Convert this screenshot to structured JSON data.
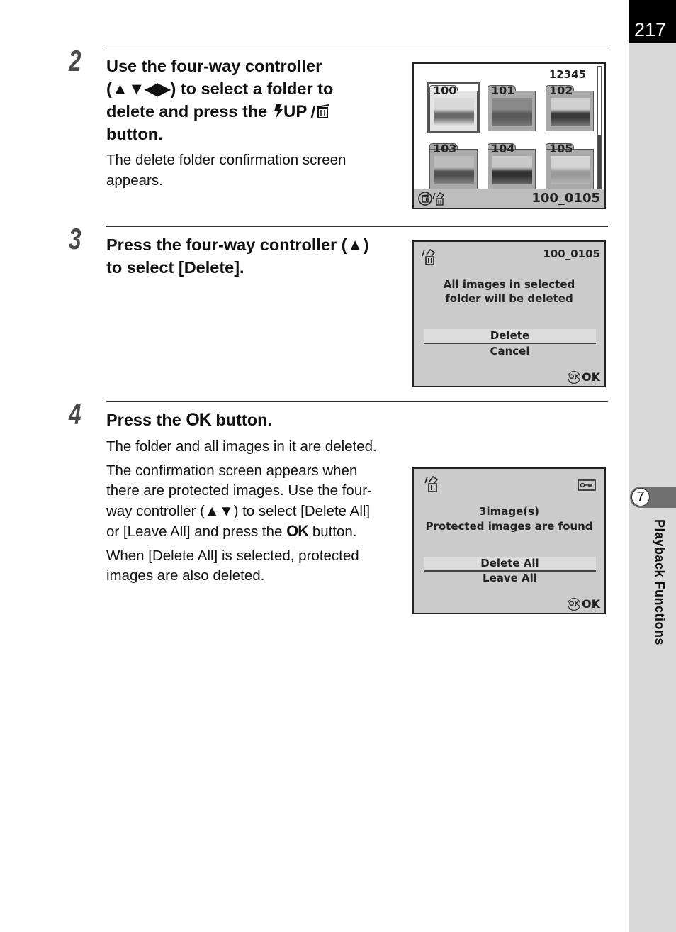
{
  "page": {
    "number": "217",
    "chapter_number": "7",
    "chapter_title": "Playback Functions"
  },
  "steps": [
    {
      "number": "2",
      "heading_lines": [
        "Use the four-way controller",
        "(▲▼◀▶) to select a folder to",
        "delete and press the ",
        "button."
      ],
      "heading_glyph": "⚡UP/🗑",
      "body": [
        "The delete folder confirmation screen",
        "appears."
      ]
    },
    {
      "number": "3",
      "heading_lines": [
        "Press the four-way controller (▲)",
        "to select [Delete]."
      ]
    },
    {
      "number": "4",
      "heading_pre": "Press the ",
      "heading_ok": "OK",
      "heading_post": " button.",
      "body": [
        "The folder and all images in it are deleted.",
        "The confirmation screen appears when",
        "there are protected images. Use the four-",
        "way controller (▲▼) to select [Delete All]",
        "or [Leave All] and press the ",
        " button.",
        "When [Delete All] is selected, protected",
        "images are also deleted."
      ],
      "body_ok": "OK"
    }
  ],
  "screens": {
    "folder_list": {
      "counter": "12345",
      "folders": [
        {
          "label": "100",
          "selected": true
        },
        {
          "label": "101",
          "selected": false
        },
        {
          "label": "102",
          "selected": false
        },
        {
          "label": "103",
          "selected": false
        },
        {
          "label": "104",
          "selected": false
        },
        {
          "label": "105",
          "selected": false
        }
      ],
      "footer_icons": [
        "trash-circle-icon",
        "delete-folder-icon"
      ],
      "footer_text": "100_0105",
      "scrollbar_position": 0.55
    },
    "delete_confirm": {
      "icon": "delete-folder-icon",
      "folder": "100_0105",
      "message_lines": [
        "All images in selected",
        "folder will be deleted"
      ],
      "options": [
        {
          "label": "Delete",
          "selected": true
        },
        {
          "label": "Cancel",
          "selected": false
        }
      ],
      "ok_icon_text": "OK",
      "ok_label": "OK"
    },
    "protected_confirm": {
      "icon": "delete-folder-icon",
      "right_icon": "protect-key-icon",
      "message_lines": [
        "3image(s)",
        "Protected images are found"
      ],
      "options": [
        {
          "label": "Delete All",
          "selected": true
        },
        {
          "label": "Leave All",
          "selected": false
        }
      ],
      "ok_icon_text": "OK",
      "ok_label": "OK"
    }
  }
}
